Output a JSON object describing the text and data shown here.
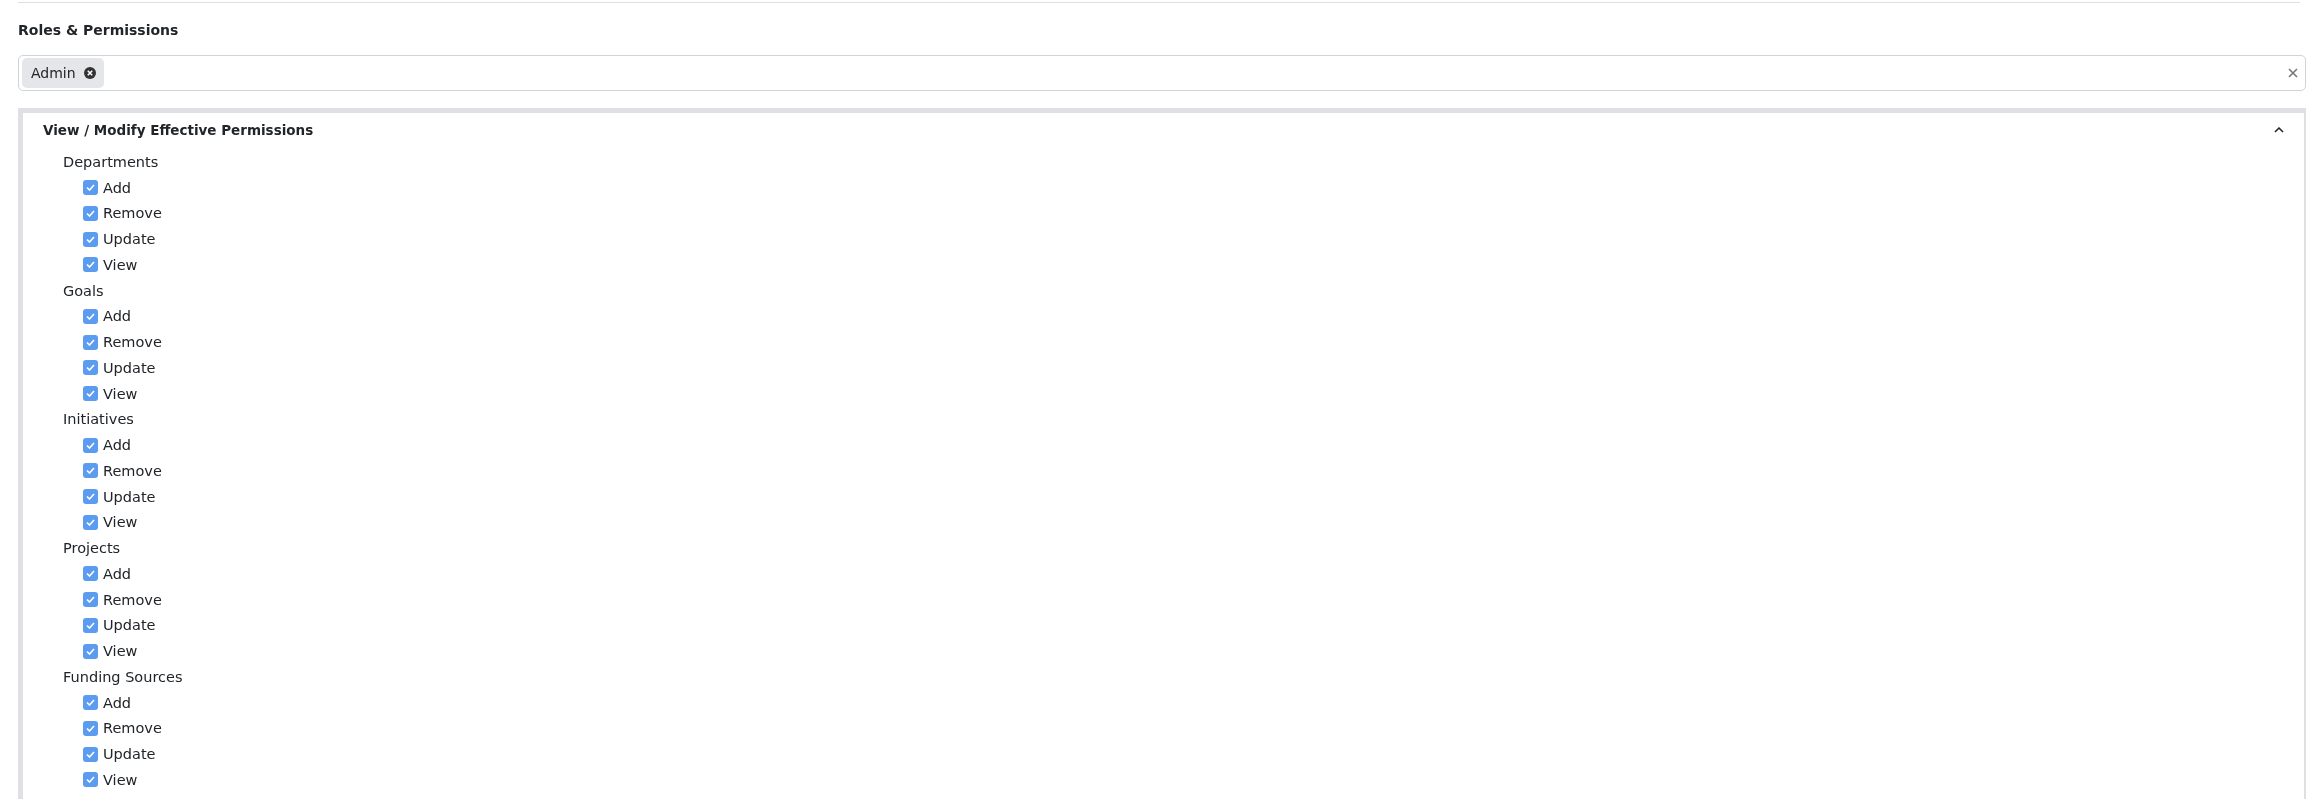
{
  "section_title": "Roles & Permissions",
  "role_select": {
    "tags": [
      {
        "label": "Admin"
      }
    ]
  },
  "permissions_panel": {
    "title": "View / Modify Effective Permissions",
    "expanded": true,
    "groups": [
      {
        "label": "Departments",
        "items": [
          {
            "label": "Add",
            "checked": true
          },
          {
            "label": "Remove",
            "checked": true
          },
          {
            "label": "Update",
            "checked": true
          },
          {
            "label": "View",
            "checked": true
          }
        ]
      },
      {
        "label": "Goals",
        "items": [
          {
            "label": "Add",
            "checked": true
          },
          {
            "label": "Remove",
            "checked": true
          },
          {
            "label": "Update",
            "checked": true
          },
          {
            "label": "View",
            "checked": true
          }
        ]
      },
      {
        "label": "Initiatives",
        "items": [
          {
            "label": "Add",
            "checked": true
          },
          {
            "label": "Remove",
            "checked": true
          },
          {
            "label": "Update",
            "checked": true
          },
          {
            "label": "View",
            "checked": true
          }
        ]
      },
      {
        "label": "Projects",
        "items": [
          {
            "label": "Add",
            "checked": true
          },
          {
            "label": "Remove",
            "checked": true
          },
          {
            "label": "Update",
            "checked": true
          },
          {
            "label": "View",
            "checked": true
          }
        ]
      },
      {
        "label": "Funding Sources",
        "items": [
          {
            "label": "Add",
            "checked": true
          },
          {
            "label": "Remove",
            "checked": true
          },
          {
            "label": "Update",
            "checked": true
          },
          {
            "label": "View",
            "checked": true
          }
        ]
      }
    ]
  }
}
